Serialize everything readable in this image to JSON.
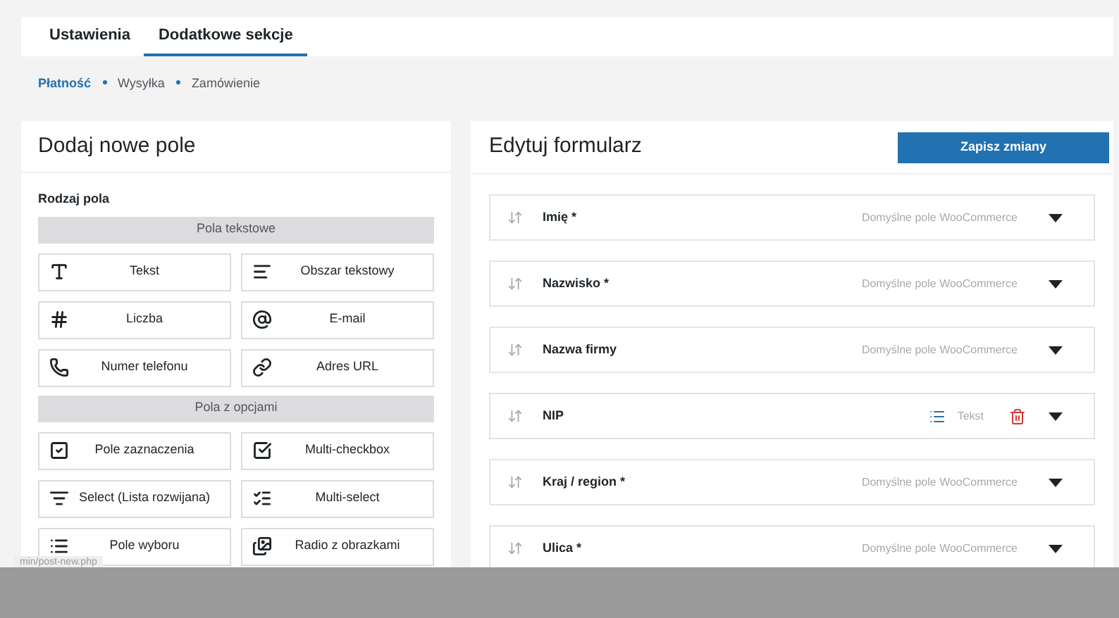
{
  "tabs": [
    {
      "label": "Ustawienia",
      "selected": false
    },
    {
      "label": "Dodatkowe sekcje",
      "selected": true
    }
  ],
  "subnav": [
    {
      "label": "Płatność",
      "selected": true
    },
    {
      "label": "Wysyłka",
      "selected": false
    },
    {
      "label": "Zamówienie",
      "selected": false
    }
  ],
  "add_panel": {
    "title": "Dodaj nowe pole",
    "field_type_label": "Rodzaj pola",
    "groups": [
      {
        "title": "Pola tekstowe",
        "items": [
          {
            "kind": "text",
            "label": "Tekst"
          },
          {
            "kind": "textarea",
            "label": "Obszar tekstowy"
          },
          {
            "kind": "number",
            "label": "Liczba"
          },
          {
            "kind": "email",
            "label": "E-mail"
          },
          {
            "kind": "phone",
            "label": "Numer telefonu"
          },
          {
            "kind": "url",
            "label": "Adres URL"
          }
        ]
      },
      {
        "title": "Pola z opcjami",
        "items": [
          {
            "kind": "checkbox",
            "label": "Pole zaznaczenia"
          },
          {
            "kind": "multicheckbox",
            "label": "Multi-checkbox"
          },
          {
            "kind": "select",
            "label": "Select (Lista rozwijana)"
          },
          {
            "kind": "multiselect",
            "label": "Multi-select"
          },
          {
            "kind": "radio",
            "label": "Pole wyboru"
          },
          {
            "kind": "radioimages",
            "label": "Radio z obrazkami"
          }
        ]
      }
    ]
  },
  "edit_panel": {
    "title": "Edytuj formularz",
    "save_button": "Zapisz zmiany",
    "fields": [
      {
        "kind": "default",
        "label": "Imię *",
        "note": "Domyślne pole WooCommerce"
      },
      {
        "kind": "default",
        "label": "Nazwisko *",
        "note": "Domyślne pole WooCommerce"
      },
      {
        "kind": "default",
        "label": "Nazwa firmy",
        "note": "Domyślne pole WooCommerce"
      },
      {
        "kind": "custom",
        "label": "NIP",
        "note": "Tekst"
      },
      {
        "kind": "default",
        "label": "Kraj / region *",
        "note": "Domyślne pole WooCommerce"
      },
      {
        "kind": "default",
        "label": "Ulica *",
        "note": "Domyślne pole WooCommerce"
      }
    ]
  },
  "status_url": "min/post-new.php"
}
